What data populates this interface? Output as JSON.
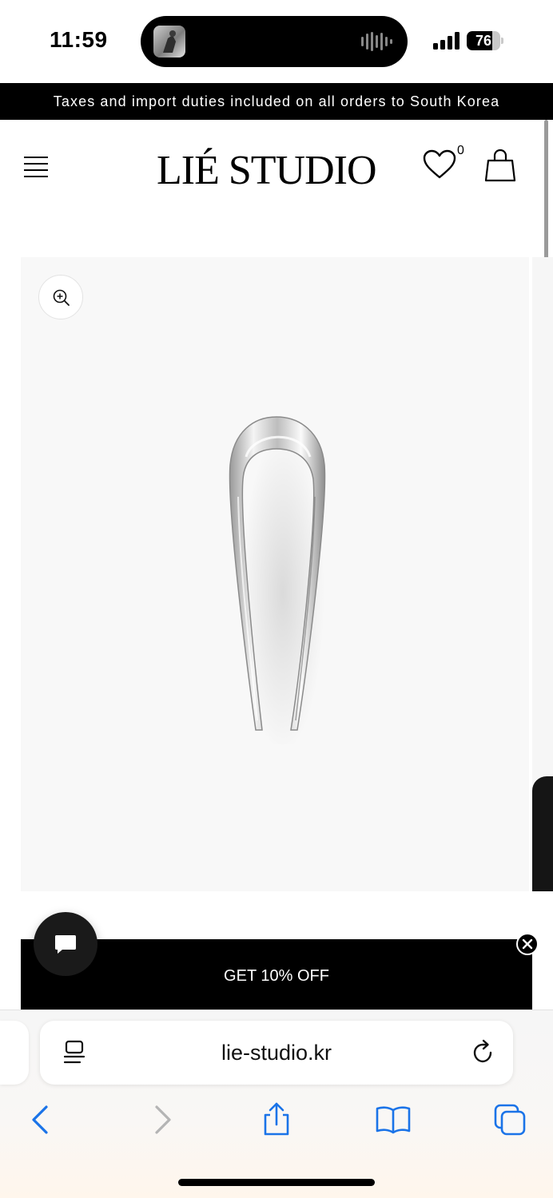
{
  "status_bar": {
    "time": "11:59",
    "battery_text": "76",
    "battery_level": 0.76
  },
  "announcement": {
    "text": "Taxes and import duties included on all orders to South Korea"
  },
  "header": {
    "brand": "LIÉ STUDIO",
    "wishlist_count": "0",
    "icons": [
      "menu-icon",
      "heart-icon",
      "shopping-bag-icon"
    ]
  },
  "gallery": {
    "zoom_icon": "zoom-in-icon"
  },
  "promo": {
    "label": "GET 10% OFF"
  },
  "browser": {
    "url": "lie-studio.kr",
    "accent_color": "#1a73e8",
    "toolbar_icons": [
      "back-icon",
      "forward-icon",
      "share-icon",
      "bookmarks-icon",
      "tabs-icon"
    ]
  },
  "colors": {
    "announcement_bg": "#000000",
    "promo_bg": "#000000",
    "gallery_bg": "#f8f8f8"
  }
}
